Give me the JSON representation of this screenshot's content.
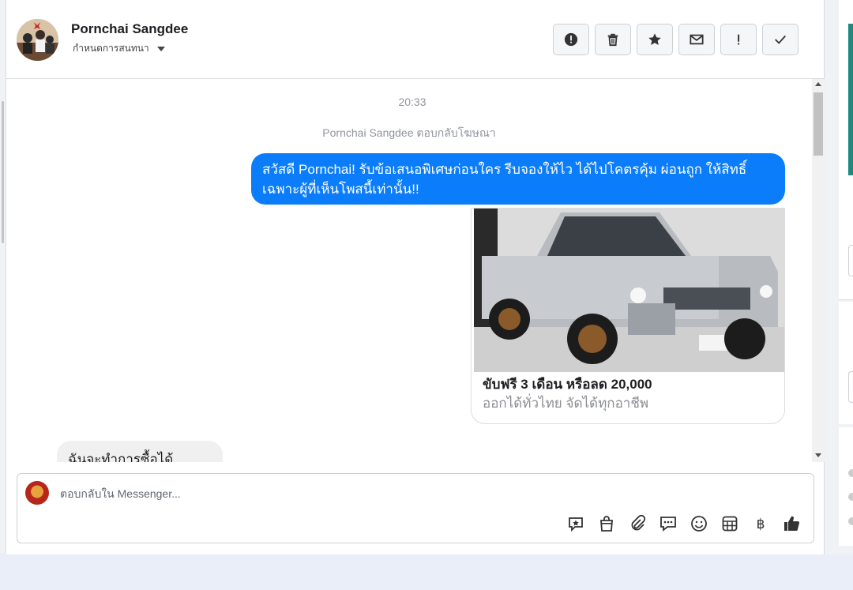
{
  "header": {
    "contact_name": "Pornchai Sangdee",
    "assign_label": "กำหนดการสนทนา",
    "actions": [
      {
        "name": "report-button",
        "icon": "alert-circle-icon"
      },
      {
        "name": "delete-button",
        "icon": "trash-icon"
      },
      {
        "name": "star-button",
        "icon": "star-icon"
      },
      {
        "name": "mark-unread-button",
        "icon": "envelope-icon"
      },
      {
        "name": "priority-button",
        "icon": "exclamation-icon"
      },
      {
        "name": "done-button",
        "icon": "check-icon"
      }
    ]
  },
  "thread": {
    "time": "20:33",
    "reply_note": "Pornchai Sangdee ตอบกลับโฆษณา",
    "outgoing_message": "สวัสดี Pornchai! รับข้อเสนอพิเศษก่อนใคร รีบจองให้ไว ได้ไปโคตรคุ้ม ผ่อนถูก ให้สิทธิ์เฉพาะผู้ที่เห็นโพสนี้เท่านั้น!!",
    "ad_card": {
      "title": "ขับฟรี 3 เดือน หรือลด 20,000",
      "subtitle": "ออกได้ทั่วไทย จัดได้ทุกอาชีพ"
    },
    "incoming_message": "ฉันจะทำการซื้อได้อย่างไร"
  },
  "composer": {
    "placeholder": "ตอบกลับใน Messenger...",
    "tools": [
      "saved-reply-icon",
      "shop-bag-icon",
      "paperclip-icon",
      "chat-bubbles-icon",
      "emoji-icon",
      "table-icon",
      "baht-icon",
      "thumbs-up-icon"
    ]
  },
  "colors": {
    "accent": "#0b7dfb",
    "teal": "#1f8a7e"
  }
}
